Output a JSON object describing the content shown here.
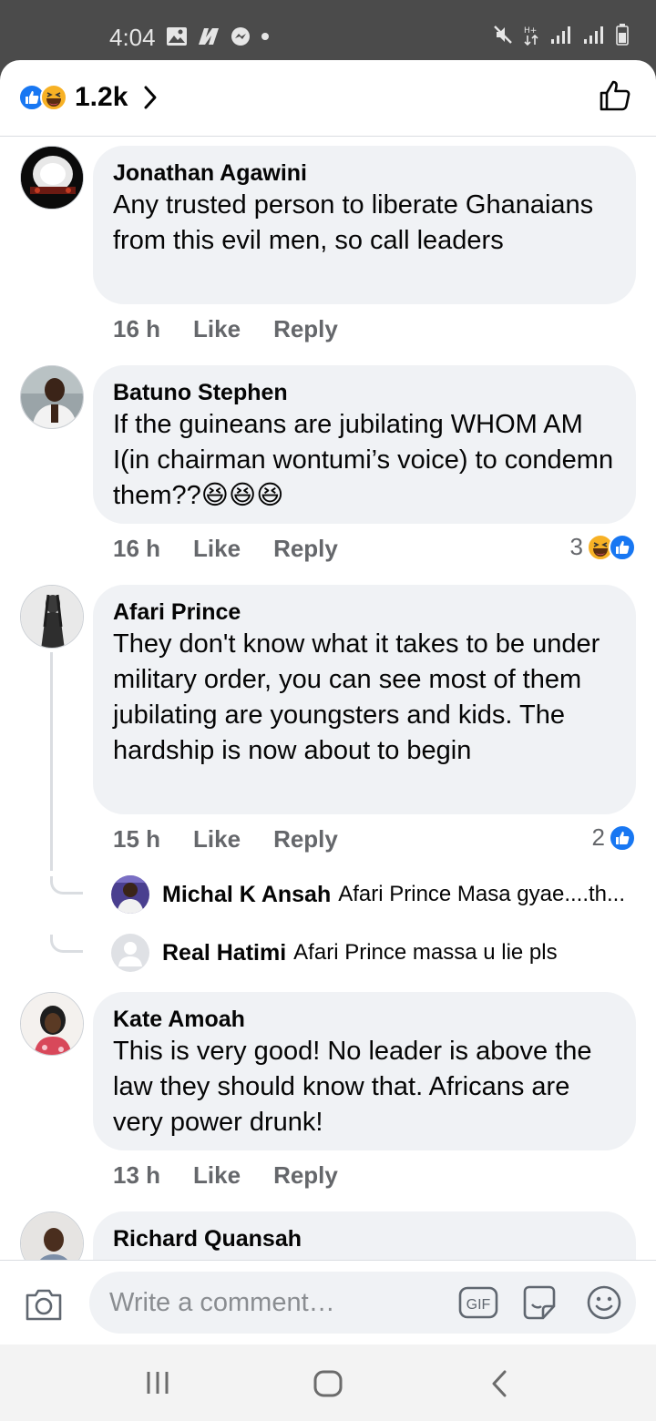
{
  "status": {
    "time": "4:04"
  },
  "header": {
    "reaction_count": "1.2k"
  },
  "comments": [
    {
      "name": "Jonathan Agawini",
      "text": "Any trusted  person to liberate Ghanaians from this evil men, so call leaders",
      "time": "16 h",
      "like": "Like",
      "reply": "Reply"
    },
    {
      "name": "Batuno Stephen",
      "text": "If the guineans are jubilating WHOM AM I(in chairman wontumi’s voice) to condemn them??😆😆😆",
      "time": "16 h",
      "like": "Like",
      "reply": "Reply",
      "reaction_count": "3"
    },
    {
      "name": "Afari Prince",
      "text": "They don't know what it takes to be under military order, you can see most of them jubilating are youngsters and kids. The hardship is now about to begin",
      "time": "15 h",
      "like": "Like",
      "reply": "Reply",
      "reaction_count": "2"
    },
    {
      "name": "Kate Amoah",
      "text": "This is very good! No leader is above the law they should know that. Africans are very power drunk!",
      "time": "13 h",
      "like": "Like",
      "reply": "Reply"
    },
    {
      "name": "Richard Quansah"
    }
  ],
  "replies": [
    {
      "name": "Michal K Ansah",
      "text": "Afari Prince Masa gyae....th..."
    },
    {
      "name": "Real Hatimi",
      "text": "Afari Prince massa u lie pls"
    }
  ],
  "composer": {
    "placeholder": "Write a comment…",
    "gif_label": "GIF"
  },
  "colors": {
    "like_blue": "#1877f2",
    "bubble": "#f0f2f5",
    "meta_gray": "#65676b"
  }
}
